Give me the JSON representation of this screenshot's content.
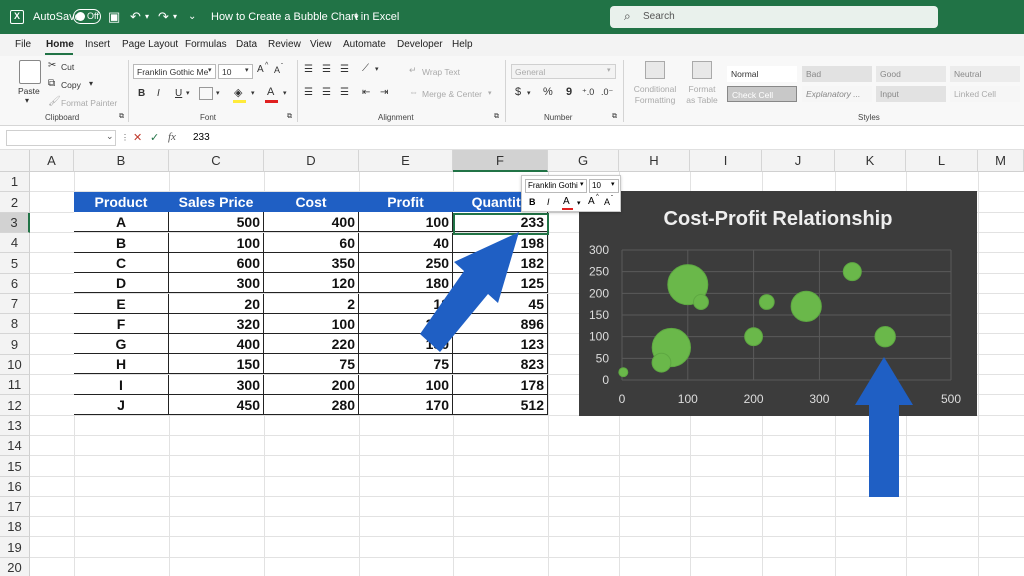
{
  "titlebar": {
    "autosave_label": "AutoSave",
    "autosave_state": "Off",
    "doc_title": "How to Create a Bubble Chart in Excel",
    "search_placeholder": "Search",
    "bg_color": "#217346"
  },
  "menu": {
    "tabs": [
      "File",
      "Home",
      "Insert",
      "Page Layout",
      "Formulas",
      "Data",
      "Review",
      "View",
      "Automate",
      "Developer",
      "Help"
    ],
    "active": "Home"
  },
  "ribbon": {
    "clipboard": {
      "paste": "Paste",
      "cut": "Cut",
      "copy": "Copy",
      "format_painter": "Format Painter",
      "label": "Clipboard"
    },
    "font": {
      "family": "Franklin Gothic Me",
      "size": "10",
      "label": "Font",
      "bold": "B",
      "italic": "I",
      "underline": "U",
      "font_color": "A",
      "grow": "A",
      "shrink": "A"
    },
    "alignment": {
      "wrap_text": "Wrap Text",
      "merge_center": "Merge & Center",
      "label": "Alignment"
    },
    "number": {
      "format": "General",
      "currency": "$",
      "percent": "%",
      "comma": "9",
      "label": "Number"
    },
    "styles": {
      "conditional_formatting": "Conditional Formatting",
      "format_as_table": "Format as Table",
      "cells": [
        "Normal",
        "Bad",
        "Good",
        "Neutral",
        "Check Cell",
        "Explanatory ...",
        "Input",
        "Linked Cell"
      ],
      "label": "Styles"
    }
  },
  "formula_bar": {
    "cancel": "✕",
    "enter": "✓",
    "fx": "fx",
    "value": "233"
  },
  "grid": {
    "columns": [
      "A",
      "B",
      "C",
      "D",
      "E",
      "F",
      "G",
      "H",
      "I",
      "J",
      "K",
      "L",
      "M"
    ],
    "selected_column": "F",
    "rows": [
      "1",
      "2",
      "3",
      "4",
      "5",
      "6",
      "7",
      "8",
      "9",
      "10",
      "11",
      "12",
      "13",
      "14",
      "15",
      "16",
      "17",
      "18",
      "19",
      "20"
    ],
    "selected_row": "3"
  },
  "table": {
    "headers": [
      "Product",
      "Sales Price",
      "Cost",
      "Profit",
      "Quantity"
    ],
    "header_color": "#1f5fc4",
    "rows": [
      [
        "A",
        "500",
        "400",
        "100",
        "233"
      ],
      [
        "B",
        "100",
        "60",
        "40",
        "198"
      ],
      [
        "C",
        "600",
        "350",
        "250",
        "182"
      ],
      [
        "D",
        "300",
        "120",
        "180",
        "125"
      ],
      [
        "E",
        "20",
        "2",
        "18",
        "45"
      ],
      [
        "F",
        "320",
        "100",
        "220",
        "896"
      ],
      [
        "G",
        "400",
        "220",
        "180",
        "123"
      ],
      [
        "H",
        "150",
        "75",
        "75",
        "823"
      ],
      [
        "I",
        "300",
        "200",
        "100",
        "178"
      ],
      [
        "J",
        "450",
        "280",
        "170",
        "512"
      ]
    ]
  },
  "mini_toolbar": {
    "font": "Franklin Gothi",
    "size": "10",
    "bold": "B",
    "italic": "I",
    "font_color": "A",
    "grow": "A",
    "shrink": "A"
  },
  "chart_data": {
    "type": "scatter",
    "title": "Cost-Profit Relationship",
    "xlabel": "",
    "ylabel": "",
    "xlim": [
      0,
      500
    ],
    "ylim": [
      0,
      300
    ],
    "xticks": [
      "0",
      "100",
      "200",
      "300",
      "500"
    ],
    "yticks": [
      "0",
      "50",
      "100",
      "150",
      "200",
      "250",
      "300"
    ],
    "grid": true,
    "legend": "none",
    "bubble_color": "#6ab84a",
    "background": "#3c3c3c",
    "points": [
      {
        "x": 400,
        "y": 100,
        "size": 233
      },
      {
        "x": 60,
        "y": 40,
        "size": 198
      },
      {
        "x": 350,
        "y": 250,
        "size": 182
      },
      {
        "x": 120,
        "y": 180,
        "size": 125
      },
      {
        "x": 2,
        "y": 18,
        "size": 45
      },
      {
        "x": 100,
        "y": 220,
        "size": 896
      },
      {
        "x": 220,
        "y": 180,
        "size": 123
      },
      {
        "x": 75,
        "y": 75,
        "size": 823
      },
      {
        "x": 200,
        "y": 100,
        "size": 178
      },
      {
        "x": 280,
        "y": 170,
        "size": 512
      }
    ]
  },
  "annotations": {
    "arrow_color": "#1f5fc4"
  }
}
